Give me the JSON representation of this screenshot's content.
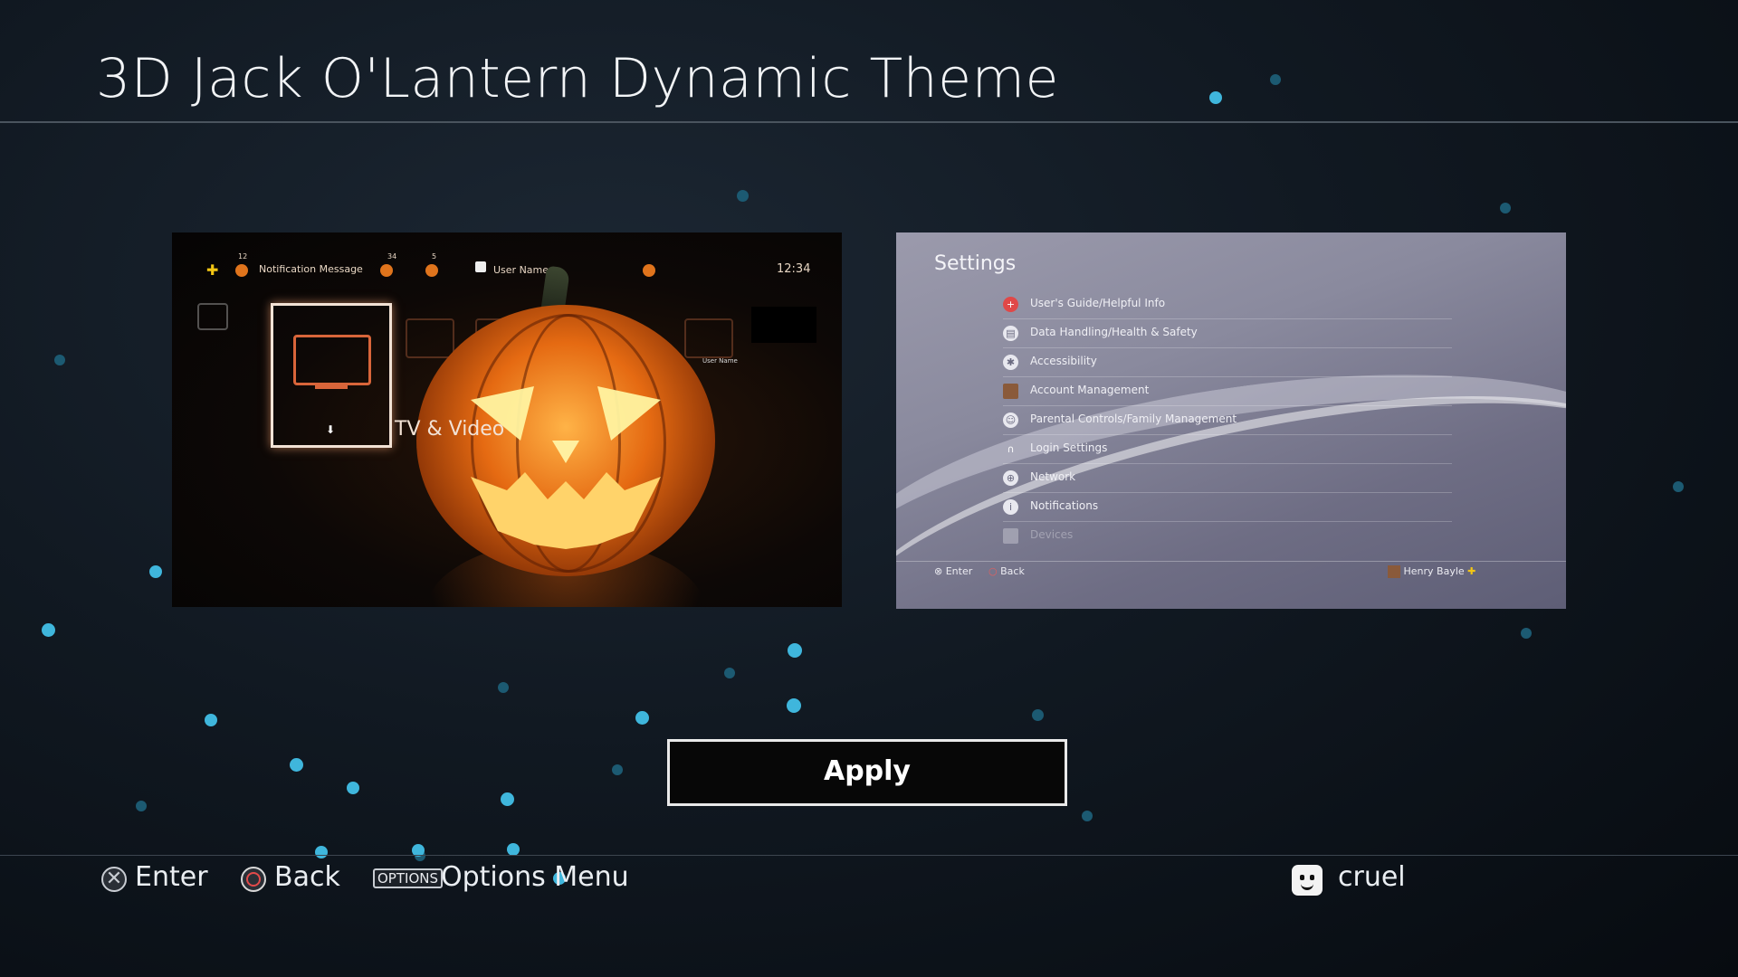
{
  "header": {
    "title": "3D Jack O'Lantern Dynamic Theme"
  },
  "preview_home": {
    "notification_count": "12",
    "notification_label": "Notification Message",
    "friends_count": "34",
    "flag_count": "5",
    "user_name": "User Name",
    "clock": "12:34",
    "focused_tile_label": "TV & Video",
    "small_user_label": "User Name"
  },
  "preview_settings": {
    "title": "Settings",
    "items": [
      {
        "label": "User's Guide/Helpful Info",
        "icon": "help-icon"
      },
      {
        "label": "Data Handling/Health & Safety",
        "icon": "document-icon"
      },
      {
        "label": "Accessibility",
        "icon": "accessibility-icon"
      },
      {
        "label": "Account Management",
        "icon": "account-avatar-icon"
      },
      {
        "label": "Parental Controls/Family Management",
        "icon": "parental-controls-icon"
      },
      {
        "label": "Login Settings",
        "icon": "login-icon"
      },
      {
        "label": "Network",
        "icon": "globe-icon"
      },
      {
        "label": "Notifications",
        "icon": "info-icon"
      },
      {
        "label": "Devices",
        "icon": "devices-icon"
      }
    ],
    "footer_enter": "Enter",
    "footer_back": "Back",
    "footer_user": "Henry Bayle"
  },
  "apply_button": {
    "label": "Apply"
  },
  "footer": {
    "enter_label": "Enter",
    "back_label": "Back",
    "options_badge": "OPTIONS",
    "options_label": "Options Menu",
    "user_name": "cruel"
  },
  "colors": {
    "particle": "#3fb6dc",
    "background": "#111922",
    "apply_border": "#e9e9e9",
    "circle_button": "#e34a4a",
    "pumpkin_orange": "#e56a12"
  }
}
